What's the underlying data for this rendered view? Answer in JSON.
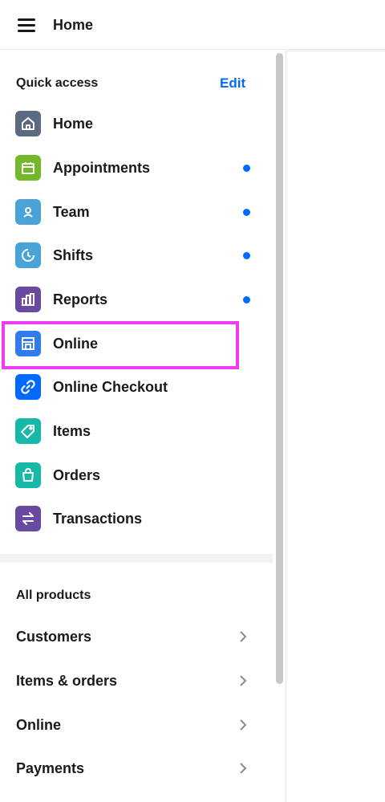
{
  "header": {
    "title": "Home",
    "menu_icon": "hamburger-icon"
  },
  "quick_access": {
    "heading": "Quick access",
    "edit_label": "Edit",
    "items": [
      {
        "label": "Home",
        "icon": "home-icon",
        "color": "#5a6a80",
        "dot": false
      },
      {
        "label": "Appointments",
        "icon": "calendar-icon",
        "color": "#73b82a",
        "dot": true
      },
      {
        "label": "Team",
        "icon": "person-icon",
        "color": "#4aa3d8",
        "dot": true
      },
      {
        "label": "Shifts",
        "icon": "clock-icon",
        "color": "#4aa3d8",
        "dot": true
      },
      {
        "label": "Reports",
        "icon": "bar-chart-icon",
        "color": "#6a4aa0",
        "dot": true
      },
      {
        "label": "Online",
        "icon": "storefront-icon",
        "color": "#2f7bf0",
        "dot": false
      },
      {
        "label": "Online Checkout",
        "icon": "link-icon",
        "color": "#006aff",
        "dot": false
      },
      {
        "label": "Items",
        "icon": "tag-icon",
        "color": "#16b8a8",
        "dot": false
      },
      {
        "label": "Orders",
        "icon": "shopping-bag-icon",
        "color": "#16b8a8",
        "dot": false
      },
      {
        "label": "Transactions",
        "icon": "swap-arrows-icon",
        "color": "#6a4aa0",
        "dot": false
      }
    ]
  },
  "all_products": {
    "heading": "All products",
    "items": [
      {
        "label": "Customers"
      },
      {
        "label": "Items & orders"
      },
      {
        "label": "Online"
      },
      {
        "label": "Payments"
      }
    ]
  },
  "colors": {
    "accent": "#006aff",
    "highlight": "#f03cf0"
  }
}
